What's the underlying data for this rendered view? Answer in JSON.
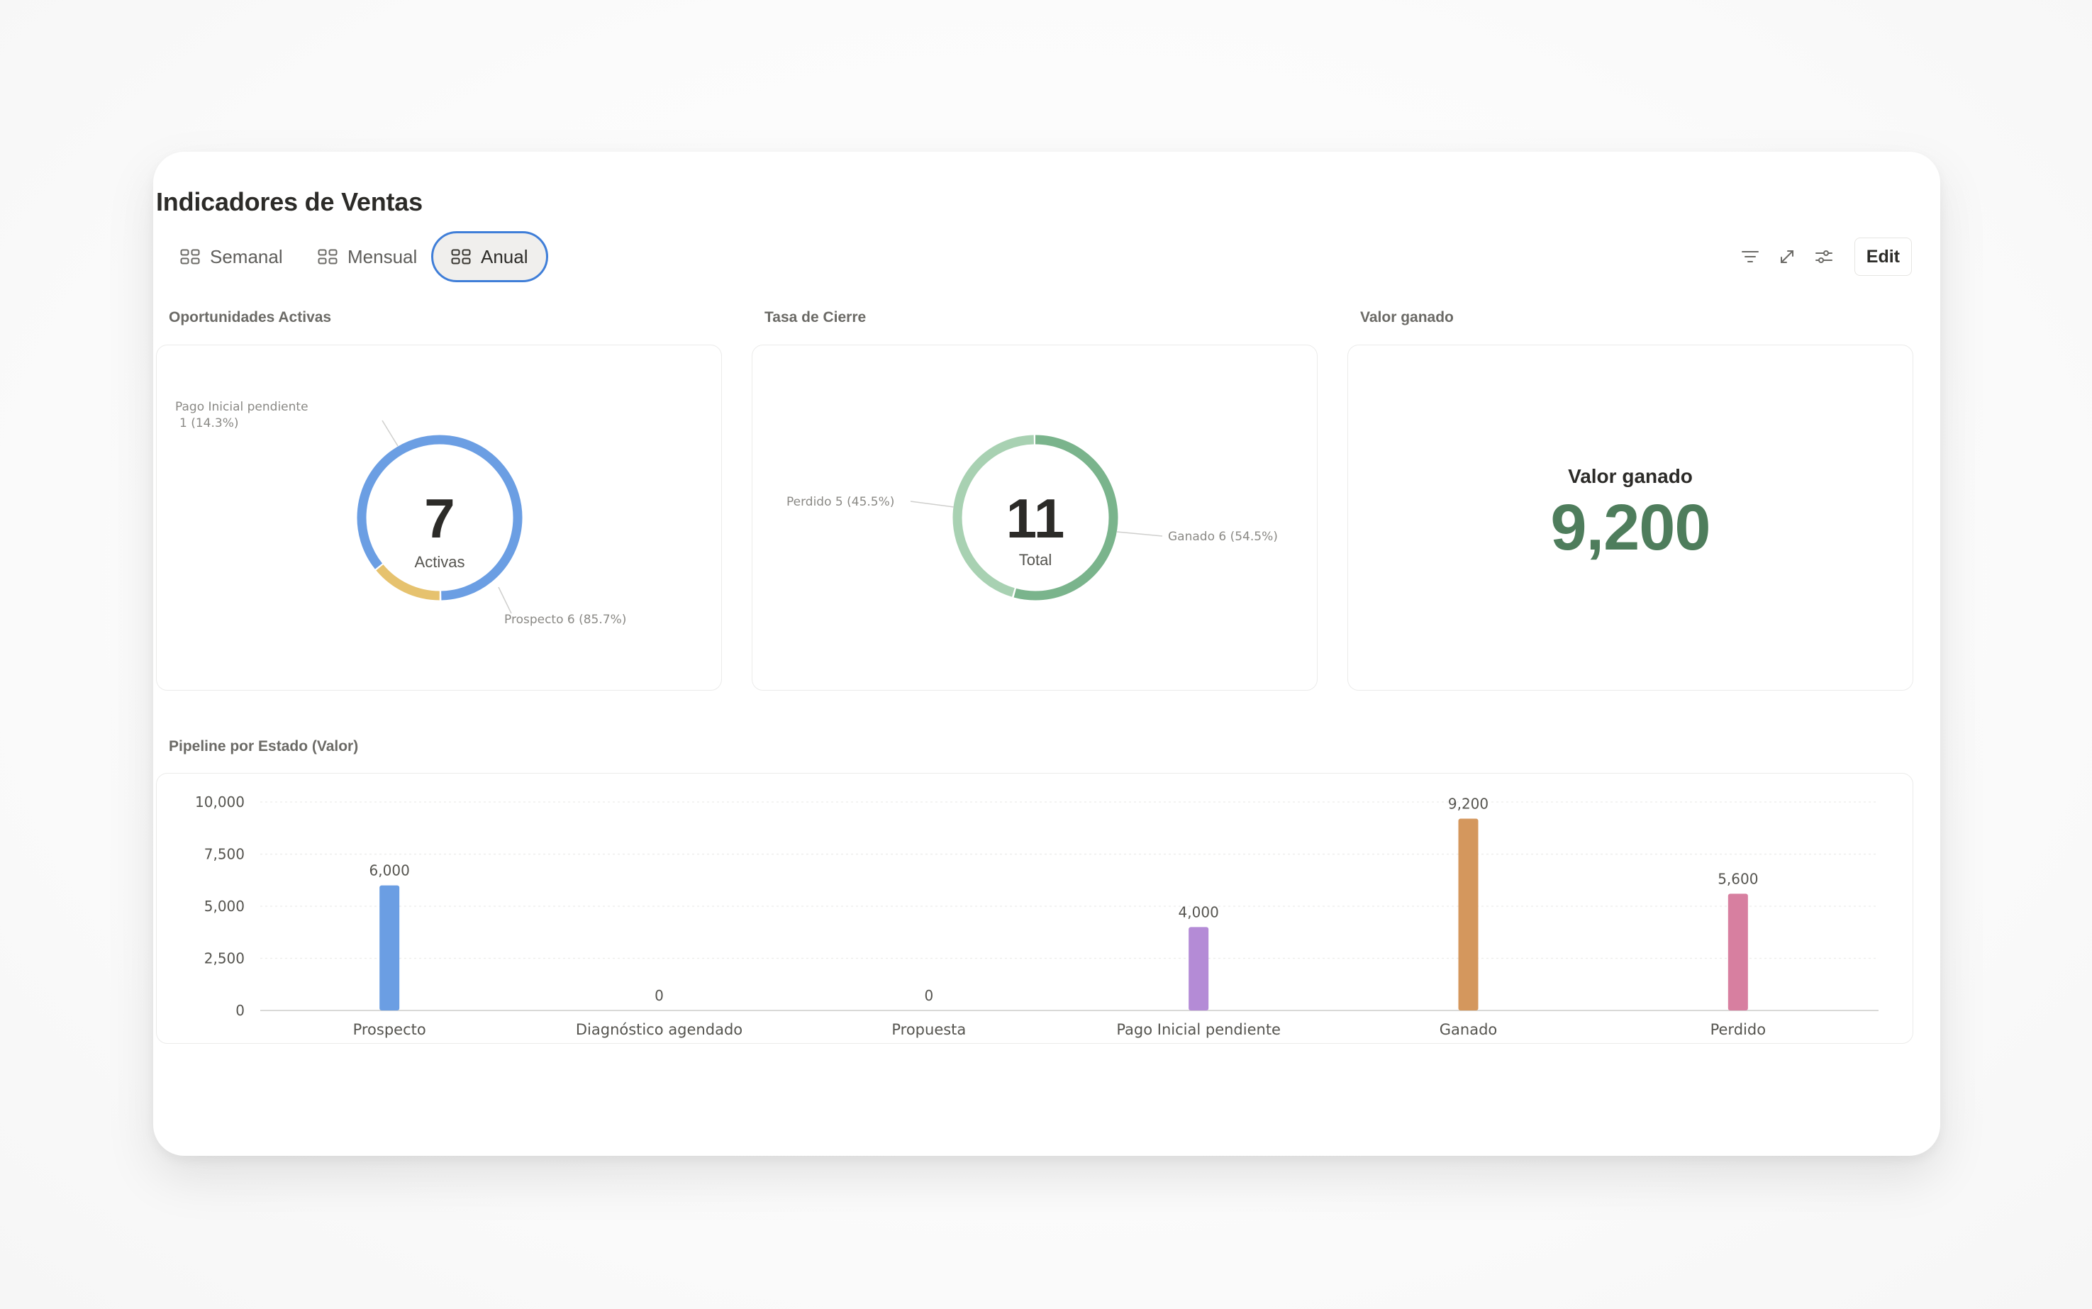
{
  "title": "Indicadores de Ventas",
  "tabs": [
    {
      "label": "Semanal",
      "active": false
    },
    {
      "label": "Mensual",
      "active": false
    },
    {
      "label": "Anual",
      "active": true
    }
  ],
  "toolbar": {
    "icons": [
      "filter-icon",
      "expand-icon",
      "settings-sliders-icon"
    ],
    "edit_label": "Edit"
  },
  "sections": {
    "oportunidades": "Oportunidades Activas",
    "tasa": "Tasa de Cierre",
    "valor": "Valor ganado",
    "pipeline": "Pipeline por Estado (Valor)"
  },
  "oportunidades_chart": {
    "center_value": "7",
    "center_label": "Activas",
    "label_pago_line1": "Pago Inicial pendiente",
    "label_pago_line2": "1 (14.3%)",
    "label_prospecto": "Prospecto  6 (85.7%)",
    "colors": {
      "prospecto": "#6b9ee3",
      "pago": "#e6c26e"
    }
  },
  "tasa_chart": {
    "center_value": "11",
    "center_label": "Total",
    "label_perdido": "Perdido  5 (45.5%)",
    "label_ganado": "Ganado  6 (54.5%)",
    "colors": {
      "ganado": "#7ab48c",
      "perdido": "#a8d1b2"
    }
  },
  "kpi": {
    "title": "Valor ganado",
    "value": "9,200",
    "color": "#4e7d5c"
  },
  "chart_data": [
    {
      "type": "pie",
      "title": "Oportunidades Activas",
      "categories": [
        "Prospecto",
        "Pago Inicial pendiente"
      ],
      "values": [
        6,
        1
      ],
      "percent": [
        85.7,
        14.3
      ],
      "center_text": "7 Activas"
    },
    {
      "type": "pie",
      "title": "Tasa de Cierre",
      "categories": [
        "Ganado",
        "Perdido"
      ],
      "values": [
        6,
        5
      ],
      "percent": [
        54.5,
        45.5
      ],
      "center_text": "11 Total"
    },
    {
      "type": "bar",
      "title": "Pipeline por Estado (Valor)",
      "categories": [
        "Prospecto",
        "Diagnóstico agendado",
        "Propuesta",
        "Pago Inicial pendiente",
        "Ganado",
        "Perdido"
      ],
      "values": [
        6000,
        0,
        0,
        4000,
        9200,
        5600
      ],
      "value_labels": [
        "6,000",
        "0",
        "0",
        "4,000",
        "9,200",
        "5,600"
      ],
      "colors": [
        "#6b9ee3",
        "#b9b9b9",
        "#b9b9b9",
        "#b48bd6",
        "#d4975d",
        "#d77fa0"
      ],
      "ylim": [
        0,
        10000
      ],
      "yticks": [
        "0",
        "2,500",
        "5,000",
        "7,500",
        "10,000"
      ],
      "ytick_values": [
        0,
        2500,
        5000,
        7500,
        10000
      ],
      "grid": true,
      "xlabel": "",
      "ylabel": ""
    }
  ]
}
